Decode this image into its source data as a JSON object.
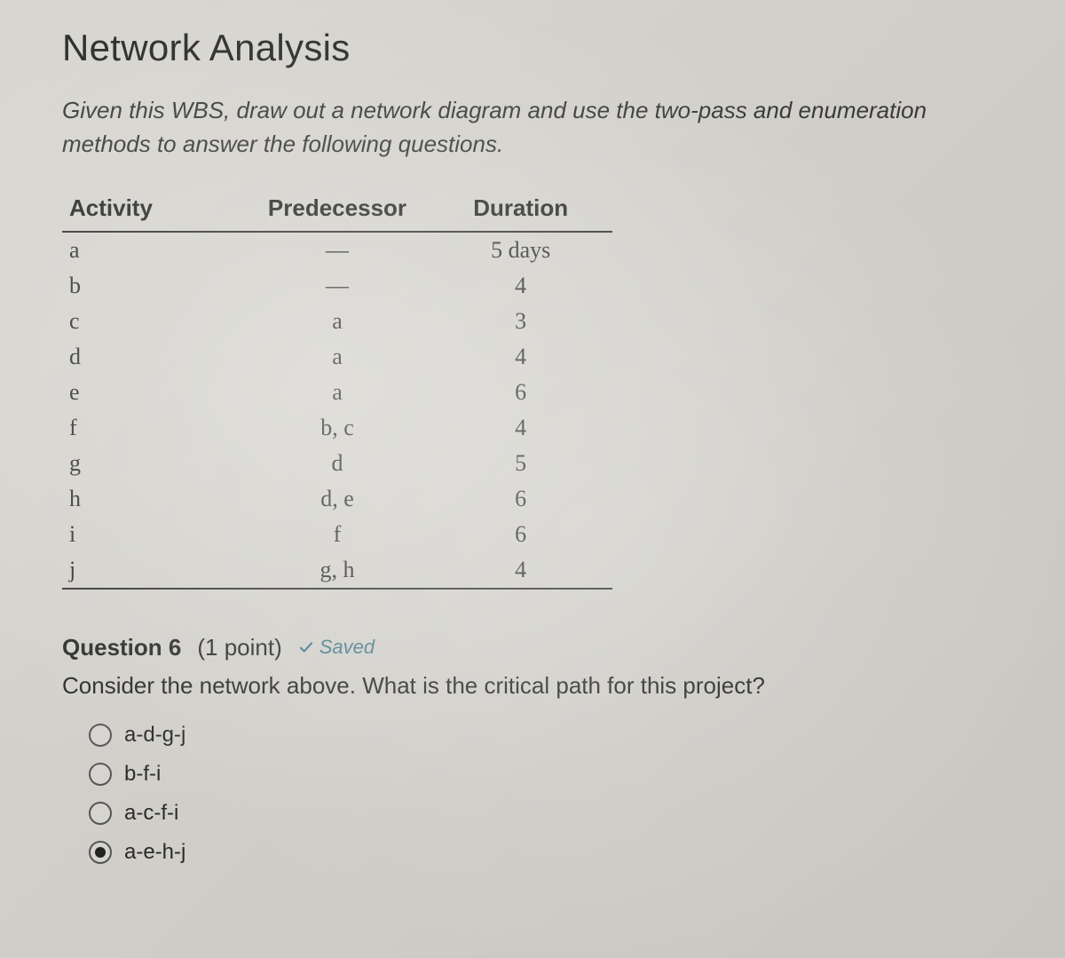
{
  "title": "Network Analysis",
  "intro": "Given this WBS, draw out a network diagram and use the two-pass and enumeration methods to answer the following questions.",
  "table": {
    "headers": {
      "activity": "Activity",
      "predecessor": "Predecessor",
      "duration": "Duration"
    },
    "rows": [
      {
        "activity": "a",
        "predecessor": "—",
        "duration": "5 days"
      },
      {
        "activity": "b",
        "predecessor": "—",
        "duration": "4"
      },
      {
        "activity": "c",
        "predecessor": "a",
        "duration": "3"
      },
      {
        "activity": "d",
        "predecessor": "a",
        "duration": "4"
      },
      {
        "activity": "e",
        "predecessor": "a",
        "duration": "6"
      },
      {
        "activity": "f",
        "predecessor": "b, c",
        "duration": "4"
      },
      {
        "activity": "g",
        "predecessor": "d",
        "duration": "5"
      },
      {
        "activity": "h",
        "predecessor": "d, e",
        "duration": "6"
      },
      {
        "activity": "i",
        "predecessor": "f",
        "duration": "6"
      },
      {
        "activity": "j",
        "predecessor": "g, h",
        "duration": "4"
      }
    ]
  },
  "question": {
    "title": "Question 6",
    "points": "(1 point)",
    "saved": "Saved",
    "text": "Consider the network above. What is the critical path for this project?",
    "options": [
      {
        "label": "a-d-g-j",
        "checked": false
      },
      {
        "label": "b-f-i",
        "checked": false
      },
      {
        "label": "a-c-f-i",
        "checked": false
      },
      {
        "label": "a-e-h-j",
        "checked": true
      }
    ]
  }
}
